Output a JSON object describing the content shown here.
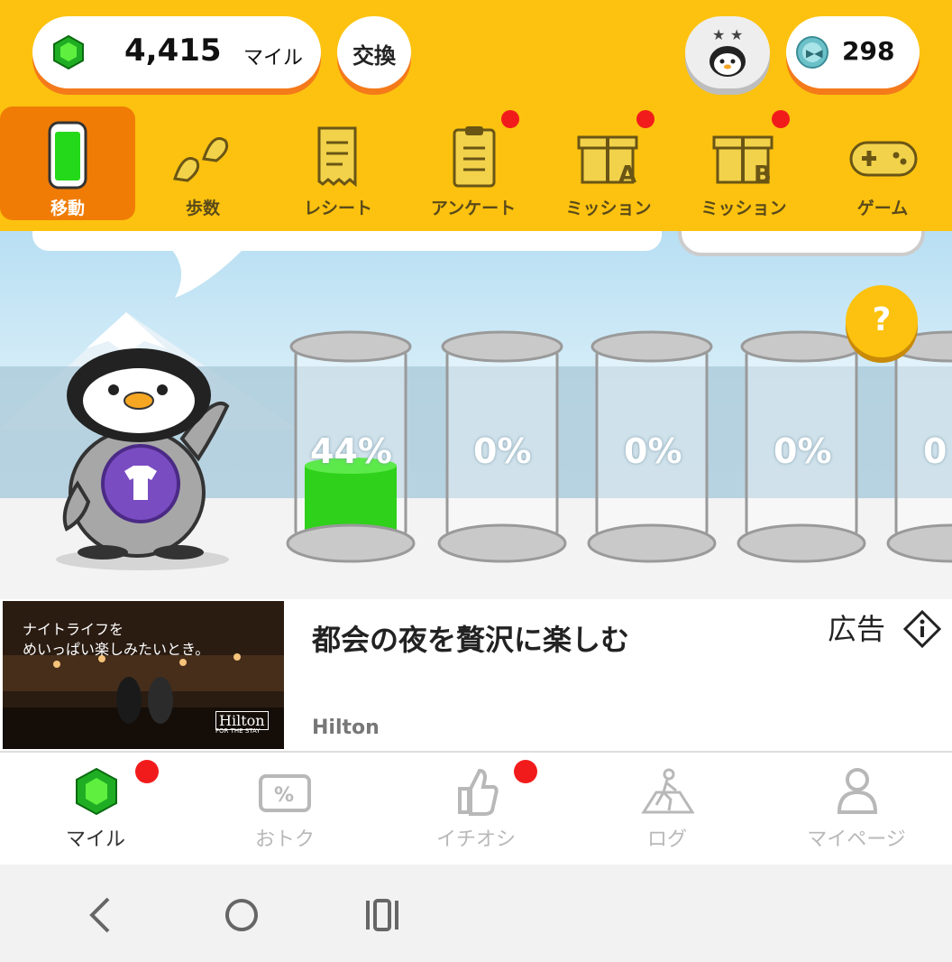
{
  "header": {
    "miles_value": "4,415",
    "miles_unit": "マイル",
    "exchange_label": "交換",
    "coins_value": "298"
  },
  "tabs": [
    {
      "label": "移動",
      "icon": "battery-tank-icon",
      "active": true,
      "badge": false
    },
    {
      "label": "歩数",
      "icon": "footprints-icon",
      "active": false,
      "badge": false
    },
    {
      "label": "レシート",
      "icon": "receipt-icon",
      "active": false,
      "badge": false
    },
    {
      "label": "アンケート",
      "icon": "clipboard-icon",
      "active": false,
      "badge": true
    },
    {
      "label": "ミッション",
      "icon": "gift-a-icon",
      "active": false,
      "badge": true
    },
    {
      "label": "ミッション",
      "icon": "gift-b-icon",
      "active": false,
      "badge": true
    },
    {
      "label": "ゲーム",
      "icon": "gamepad-icon",
      "active": false,
      "badge": false
    }
  ],
  "tanks": [
    {
      "label": "44%",
      "fill": 0.44
    },
    {
      "label": "0%",
      "fill": 0
    },
    {
      "label": "0%",
      "fill": 0
    },
    {
      "label": "0%",
      "fill": 0
    },
    {
      "label": "0",
      "fill": 0
    }
  ],
  "help_label": "?",
  "ad": {
    "image_line1": "ナイトライフを",
    "image_line2": "めいっぱい楽しみたいとき。",
    "image_brand": "Hilton",
    "image_tagline": "FOR THE STAY",
    "title": "都会の夜を贅沢に楽しむ",
    "brand": "Hilton",
    "label": "広告"
  },
  "bottom_nav": [
    {
      "label": "マイル",
      "icon": "gem-icon",
      "active": true,
      "badge": true
    },
    {
      "label": "おトク",
      "icon": "percent-ticket-icon",
      "active": false,
      "badge": false
    },
    {
      "label": "イチオシ",
      "icon": "thumbs-up-icon",
      "active": false,
      "badge": true
    },
    {
      "label": "ログ",
      "icon": "walker-icon",
      "active": false,
      "badge": false
    },
    {
      "label": "マイページ",
      "icon": "person-icon",
      "active": false,
      "badge": false
    }
  ],
  "colors": {
    "header_bg": "#fcc20f",
    "active_tab": "#f07c06",
    "badge": "#f21b1b",
    "tank_fill": "#2fd11a"
  }
}
